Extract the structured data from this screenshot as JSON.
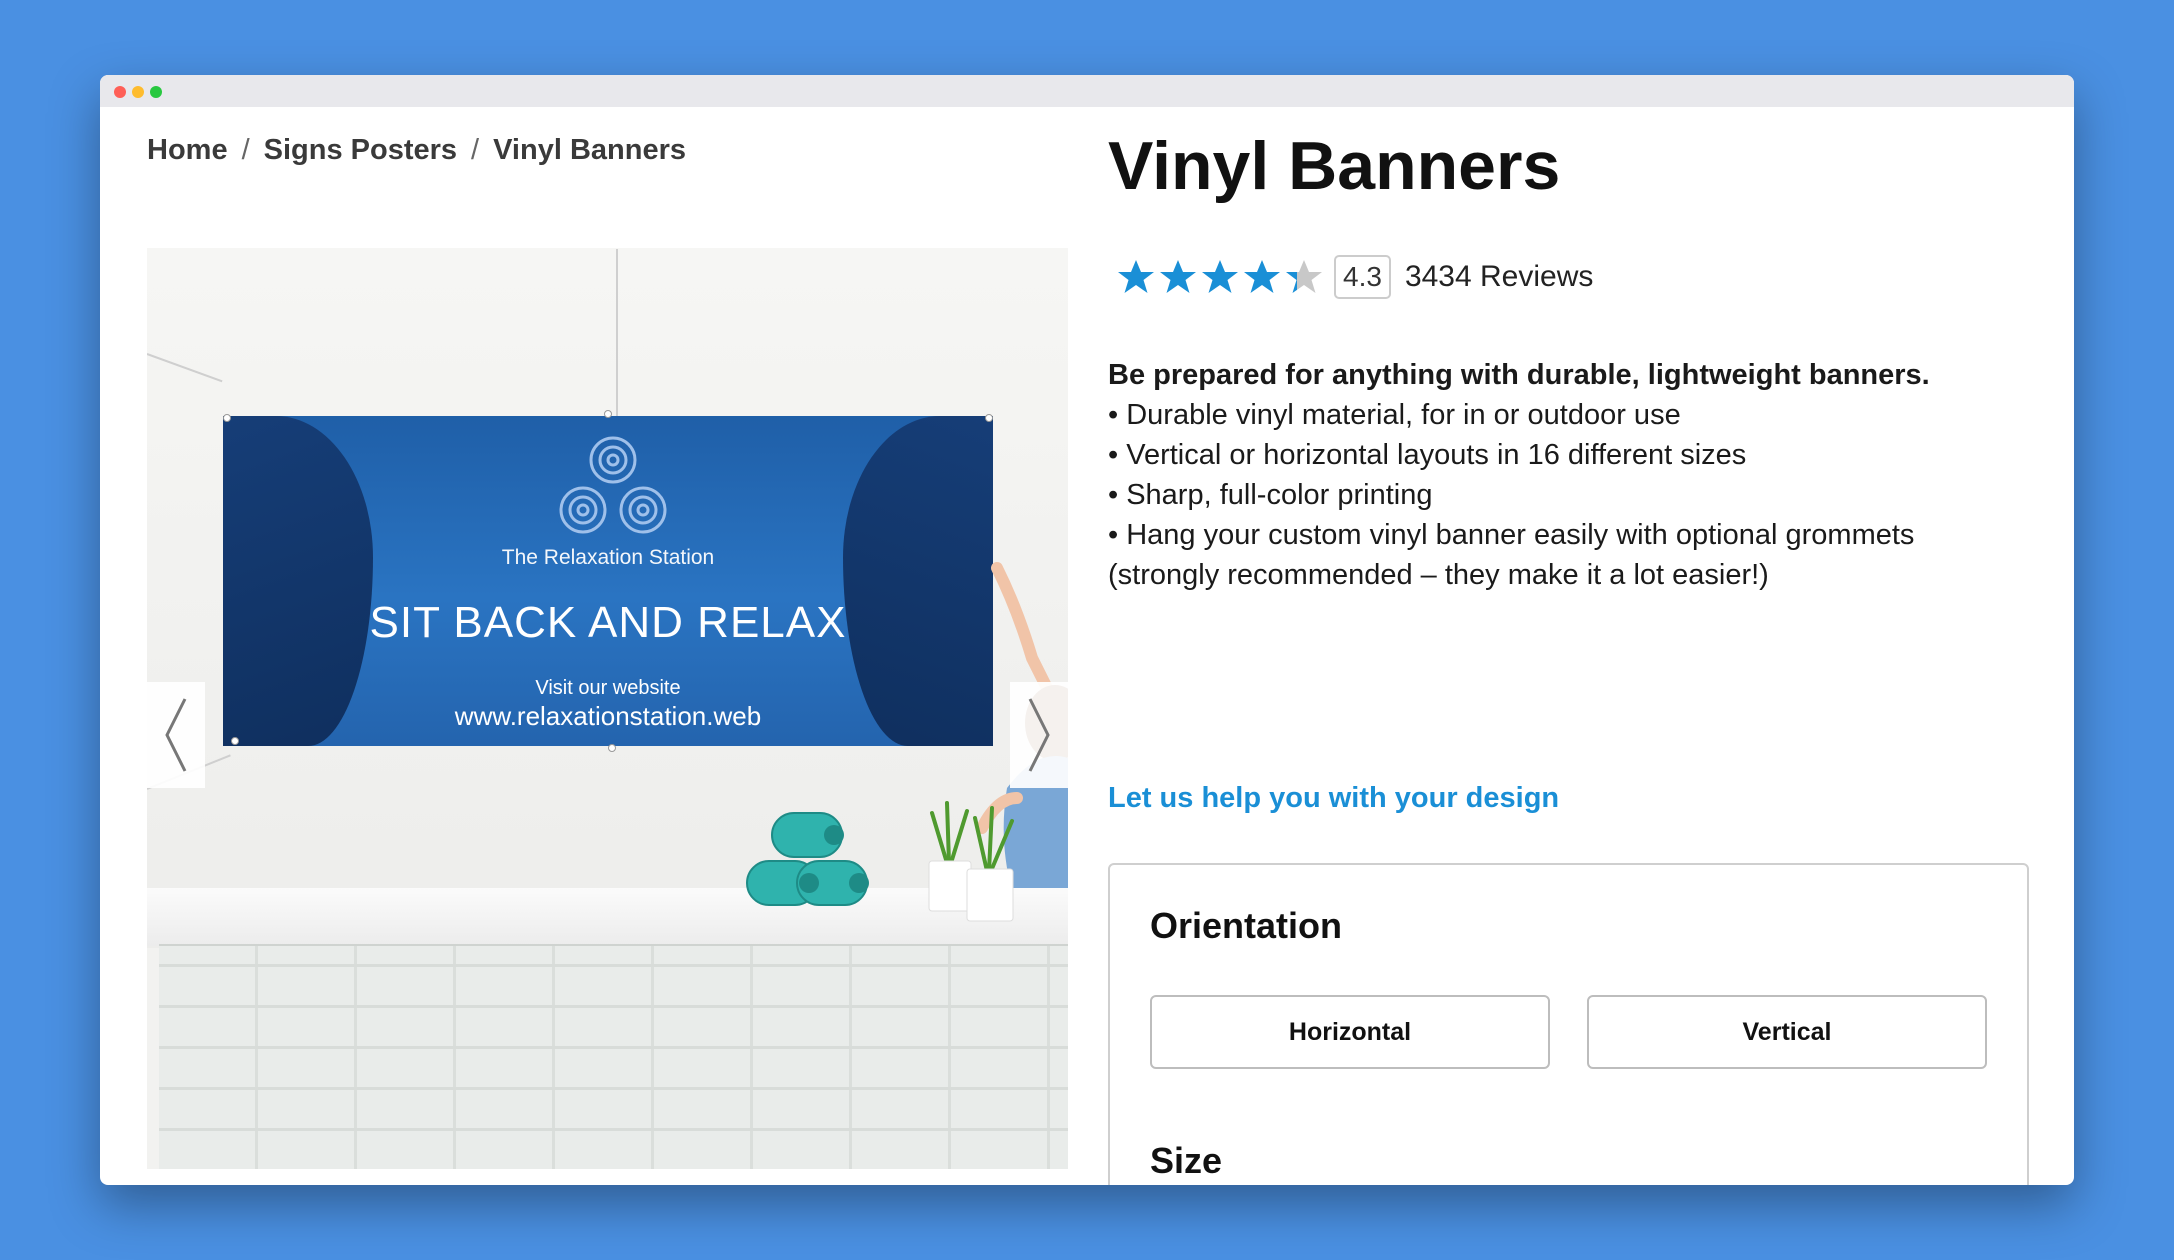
{
  "breadcrumb": {
    "items": [
      "Home",
      "Signs Posters",
      "Vinyl Banners"
    ],
    "separator": "/"
  },
  "gallery": {
    "banner": {
      "brand": "The Relaxation Station",
      "headline": "SIT BACK AND RELAX",
      "visit": "Visit our website",
      "url": "www.relaxationstation.web"
    }
  },
  "product": {
    "title": "Vinyl Banners",
    "rating": {
      "score": "4.3",
      "reviews": "3434 Reviews",
      "stars_filled": 4.3,
      "stars_max": 5
    },
    "description": {
      "lead": "Be prepared for anything with durable, lightweight banners.",
      "bullets": [
        "• Durable vinyl material, for in or outdoor use",
        "• Vertical or horizontal layouts in 16 different sizes",
        "• Sharp, full-color printing",
        "• Hang your custom vinyl banner easily with optional grommets"
      ],
      "note": "(strongly recommended – they make it a lot easier!)"
    },
    "help_link": "Let us help you with your design",
    "options": {
      "orientation_heading": "Orientation",
      "orientation_choices": [
        "Horizontal",
        "Vertical"
      ],
      "size_heading": "Size"
    }
  },
  "colors": {
    "background": "#4a90e2",
    "star": "#1a8fd6",
    "link": "#1a8fd6"
  },
  "icons": [
    "star-icon",
    "chevron-left-icon",
    "chevron-right-icon"
  ]
}
